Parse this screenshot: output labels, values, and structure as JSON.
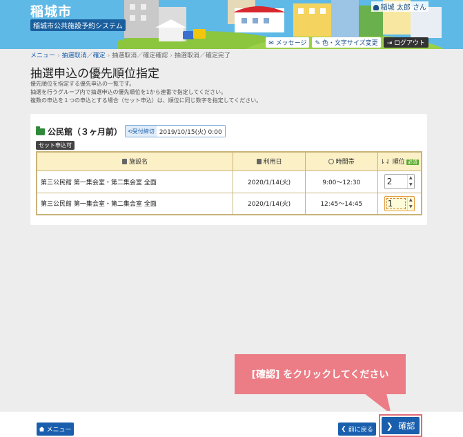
{
  "header": {
    "city": "稲城市",
    "system": "稲城市公共施設予約システム",
    "user": "稲城 太郎 さん",
    "links": [
      "メッセージ",
      "色・文字サイズ変更"
    ],
    "logout": "ログアウト"
  },
  "breadcrumb": [
    "メニュー",
    "抽選取消／確定",
    "抽選取消／確定確認",
    "抽選取消／確定完了"
  ],
  "page": {
    "title": "抽選申込の優先順位指定",
    "desc": [
      "優先順位を指定する優先申込の一覧です。",
      "抽選を行うグループ内で抽選申込の優先順位を1から連番で指定してください。",
      "複数の申込を１つの申込とする場合（セット申込）は、順位に同じ数字を指定してください。"
    ]
  },
  "group": {
    "facility": "公民館（３ヶ月前）",
    "deadline_label": "受付締切",
    "deadline": "2019/10/15(火) 0:00",
    "set_badge": "セット申込可"
  },
  "table": {
    "headers": [
      "施設名",
      "利用日",
      "時間帯",
      "順位"
    ],
    "required": "必須",
    "rows": [
      {
        "name": "第三公民館 第一集会室・第二集会室 全面",
        "date": "2020/1/14(火)",
        "time": "9:00～12:30",
        "rank": "2"
      },
      {
        "name": "第三公民館 第一集会室・第二集会室 全面",
        "date": "2020/1/14(火)",
        "time": "12:45～14:45",
        "rank": "1"
      }
    ]
  },
  "footer": {
    "menu": "メニュー",
    "back": "前に戻る",
    "confirm": "確認"
  },
  "callout": "[確認] をクリックしてください"
}
